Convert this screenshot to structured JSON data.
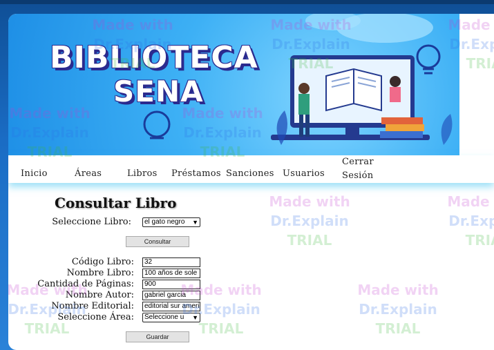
{
  "banner": {
    "title_line1": "BIBLIOTECA",
    "title_line2": "SENA"
  },
  "nav": {
    "items": [
      {
        "label": "Inicio"
      },
      {
        "label": "Áreas"
      },
      {
        "label": "Libros"
      },
      {
        "label": "Préstamos"
      },
      {
        "label": "Sanciones"
      },
      {
        "label": "Usuarios"
      },
      {
        "label": "Cerrar Sesión"
      }
    ]
  },
  "form": {
    "heading": "Consultar Libro",
    "select_book_label": "Seleccione Libro:",
    "select_book_value": "el gato negro",
    "consult_button": "Consultar",
    "fields": [
      {
        "label": "Código Libro:",
        "value": "32"
      },
      {
        "label": "Nombre Libro:",
        "value": "100 años de sole"
      },
      {
        "label": "Cantidad de Páginas:",
        "value": "900"
      },
      {
        "label": "Nombre Autor:",
        "value": "gabriel garcia"
      },
      {
        "label": "Nombre Editorial:",
        "value": "editorial sur ameri"
      }
    ],
    "area_label": "Seleccione Área:",
    "area_value": "Seleccione u",
    "save_button": "Guardar"
  },
  "watermark": {
    "line1": "Made with",
    "line2": "Dr.Explain",
    "line3": "TRIAL"
  }
}
